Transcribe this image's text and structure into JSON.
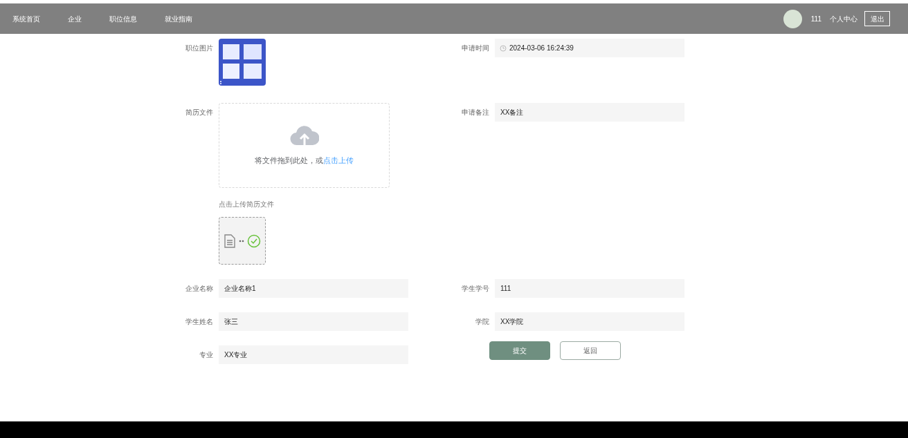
{
  "nav": {
    "items": [
      {
        "label": "系统首页"
      },
      {
        "label": "企业"
      },
      {
        "label": "职位信息"
      },
      {
        "label": "就业指南"
      }
    ],
    "user": {
      "name": "111",
      "center": "个人中心",
      "logout": "退出"
    }
  },
  "form": {
    "job_image": {
      "label": "职位图片",
      "kind": "picture"
    },
    "apply_time": {
      "label": "申请时间",
      "value": "2024-03-06 16:24:39"
    },
    "resume": {
      "label": "简历文件",
      "drop_text": "将文件拖到此处，或",
      "link": "点击上传",
      "hint": "点击上传简历文件",
      "uploaded": true
    },
    "remark": {
      "label": "申请备注",
      "value": "XX备注"
    },
    "fields": [
      {
        "label": "企业名称",
        "value": "企业名称1"
      },
      {
        "label": "学生学号",
        "value": "111"
      },
      {
        "label": "学生姓名",
        "value": "张三"
      },
      {
        "label": "学院",
        "value": "XX学院"
      },
      {
        "label": "专业",
        "value": "XX专业"
      }
    ],
    "buttons": [
      {
        "label": "提交",
        "kind": "primary"
      },
      {
        "label": "返回",
        "kind": "secondary"
      }
    ]
  }
}
